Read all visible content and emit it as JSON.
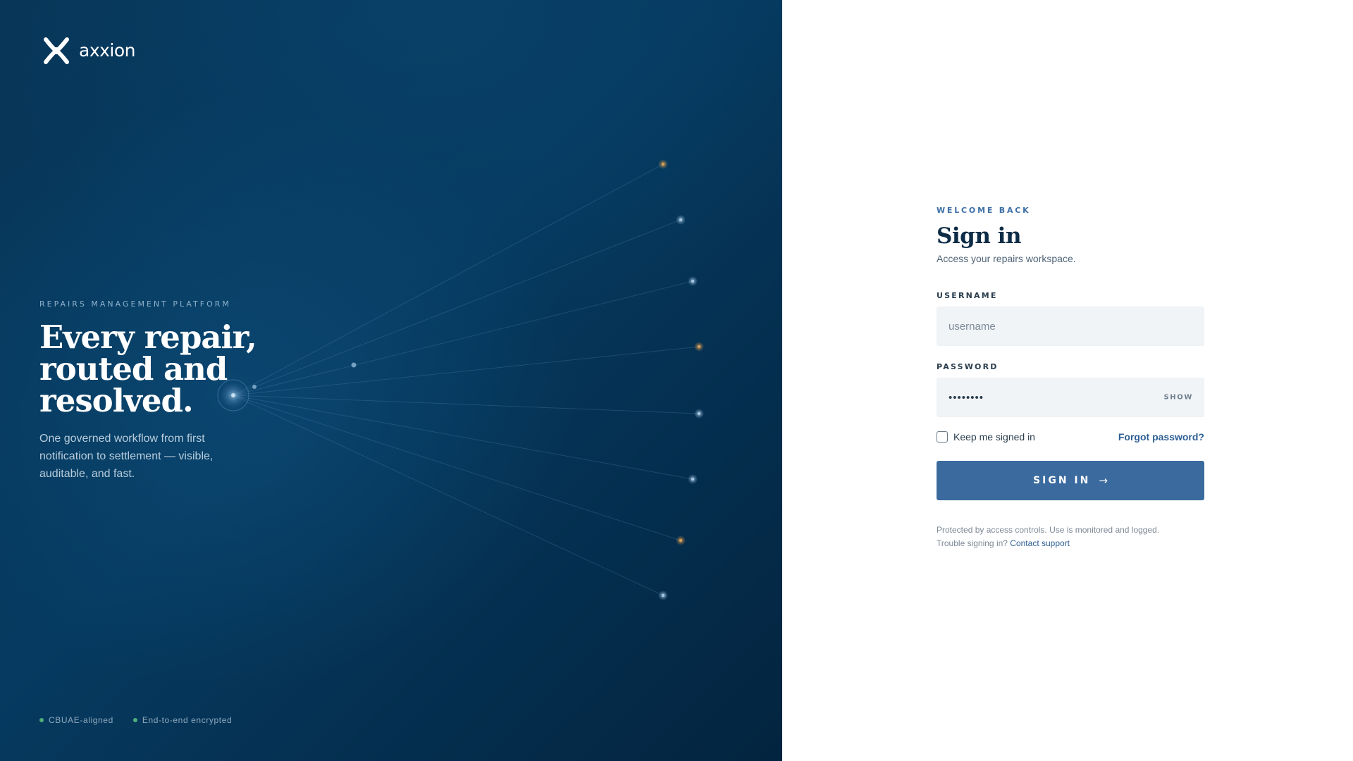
{
  "brand": {
    "name": "axxion"
  },
  "hero": {
    "eyebrow": "REPAIRS MANAGEMENT PLATFORM",
    "headline_lines": [
      "Every repair,",
      "routed and",
      "resolved."
    ],
    "subcopy": "One governed workflow from first notification to settlement — visible, auditable, and fast.",
    "badges": [
      "CBUAE-aligned",
      "End-to-end encrypted"
    ]
  },
  "form": {
    "eyebrow": "WELCOME BACK",
    "title": "Sign in",
    "subtitle": "Access your repairs workspace.",
    "username_label": "USERNAME",
    "username_placeholder": "username",
    "username_value": "",
    "password_label": "PASSWORD",
    "password_value": "••••••••",
    "show_label": "SHOW",
    "remember_label": "Keep me signed in",
    "remember_checked": false,
    "forgot_label": "Forgot password?",
    "submit_label": "SIGN IN",
    "submit_arrow": "→",
    "fine_print_1": "Protected by access controls. Use is monitored and logged.",
    "fine_print_2_prefix": "Trouble signing in?",
    "support_link": "Contact support"
  },
  "colors": {
    "hero_bg": "#063a60",
    "accent": "#3a6a9e",
    "link": "#2d5f94",
    "badge_dot": "#4fae7a",
    "node_amber": "#b08a4a",
    "node_blue": "#6f9ac0"
  },
  "icons": {
    "logo": "axxion-x-logo-icon",
    "badge": "status-dot-icon",
    "arrow": "arrow-right-icon"
  }
}
